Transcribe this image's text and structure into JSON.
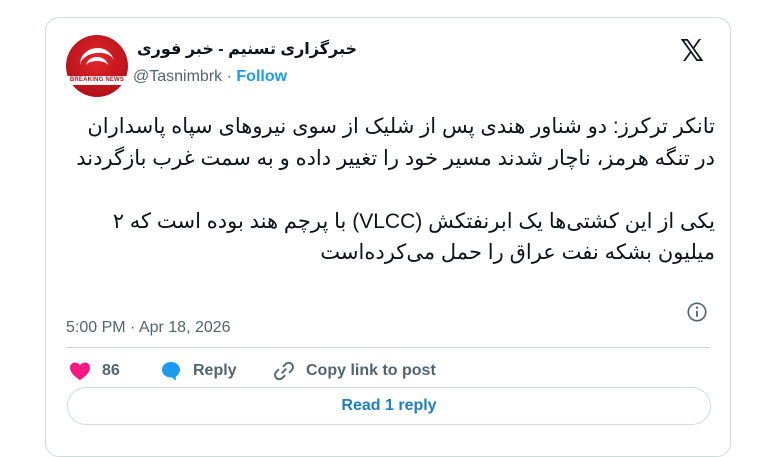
{
  "author": {
    "name": "خبرگزاری تسنیم - خبر فوری",
    "handle": "@Tasnimbrk",
    "follow_label": "Follow",
    "avatar_text": "BREAKING NEWS"
  },
  "logo": "𝕏",
  "tweet": {
    "text": "تانکر ترکرز: دو شناور هندی پس از شلیک از سوی نیروهای سپاه پاسداران در تنگه هرمز، ناچار شدند مسیر خود را تغییر داده و به سمت غرب بازگردند\n\nیکی از این کشتی‌ها یک ابرنفتکش (VLCC) با پرچم هند بوده است که ۲ میلیون بشکه نفت عراق را حمل می‌کرده‌است",
    "timestamp": "5:00 PM · Apr 18, 2026"
  },
  "actions": {
    "likes_count": "86",
    "reply_label": "Reply",
    "copy_link_label": "Copy link to post",
    "read_replies_label": "Read 1 reply"
  },
  "colors": {
    "like": "#f91880",
    "reply": "#1d9bf0",
    "accent": "#1d9bf0"
  },
  "icons": [
    "heart-icon",
    "reply-bubble-icon",
    "link-icon",
    "info-icon",
    "x-logo-icon"
  ]
}
